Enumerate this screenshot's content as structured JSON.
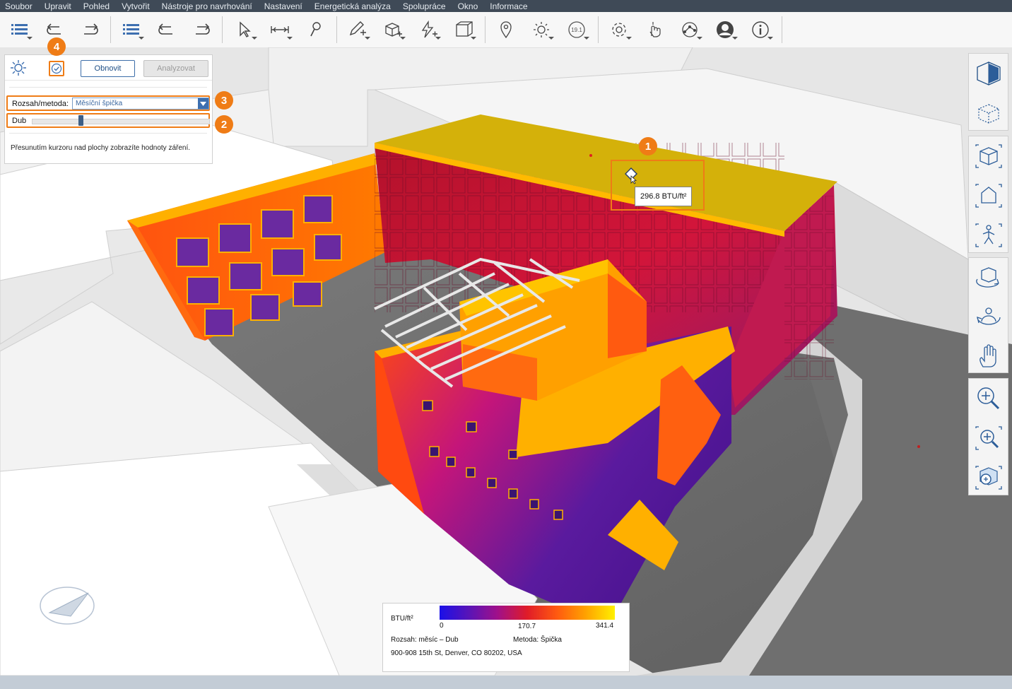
{
  "menu": [
    "Soubor",
    "Upravit",
    "Pohled",
    "Vytvořit",
    "Nástroje pro navrhování",
    "Nastavení",
    "Energetická analýza",
    "Spolupráce",
    "Okno",
    "Informace"
  ],
  "toolbar": {
    "icons": [
      "list-menu-icon",
      "undo-icon",
      "redo-icon",
      "list-menu-icon",
      "undo-icon",
      "redo-icon",
      "select-arrow-icon",
      "measure-icon",
      "paint-icon",
      "pencil-add-icon",
      "box-add-icon",
      "lightning-add-icon",
      "frame-icon",
      "location-pin-icon",
      "sun-icon",
      "badge-19-icon",
      "settings-icon",
      "hand-touch-icon",
      "globe-share-icon",
      "user-icon",
      "info-icon"
    ],
    "badge_text": "19.1"
  },
  "panel": {
    "refresh_label": "Obnovit",
    "analyze_label": "Analyzovat",
    "range_label": "Rozsah/metoda:",
    "range_value": "Měsíční špička",
    "month_label": "Dub",
    "month_index": 4,
    "month_count": 12,
    "hint": "Přesunutím kurzoru nad plochy zobrazíte hodnoty záření."
  },
  "callouts": [
    "1",
    "2",
    "3",
    "4"
  ],
  "tooltip": {
    "value": "296.8 BTU/ft²"
  },
  "legend": {
    "unit": "BTU/ft²",
    "min": "0",
    "mid": "170.7",
    "max": "341.4",
    "range": "Rozsah: měsíc – Dub",
    "method": "Metoda: Špička",
    "address": "900-908 15th St, Denver, CO 80202, USA",
    "gradient_colors": [
      "#1a10e8",
      "#5a14b6",
      "#a0108a",
      "#e01c28",
      "#ff5a10",
      "#ffa000",
      "#fff000"
    ]
  },
  "colors": {
    "accent": "#ef7c16",
    "menubar": "#3f4a57",
    "primary": "#3d6fb0"
  }
}
